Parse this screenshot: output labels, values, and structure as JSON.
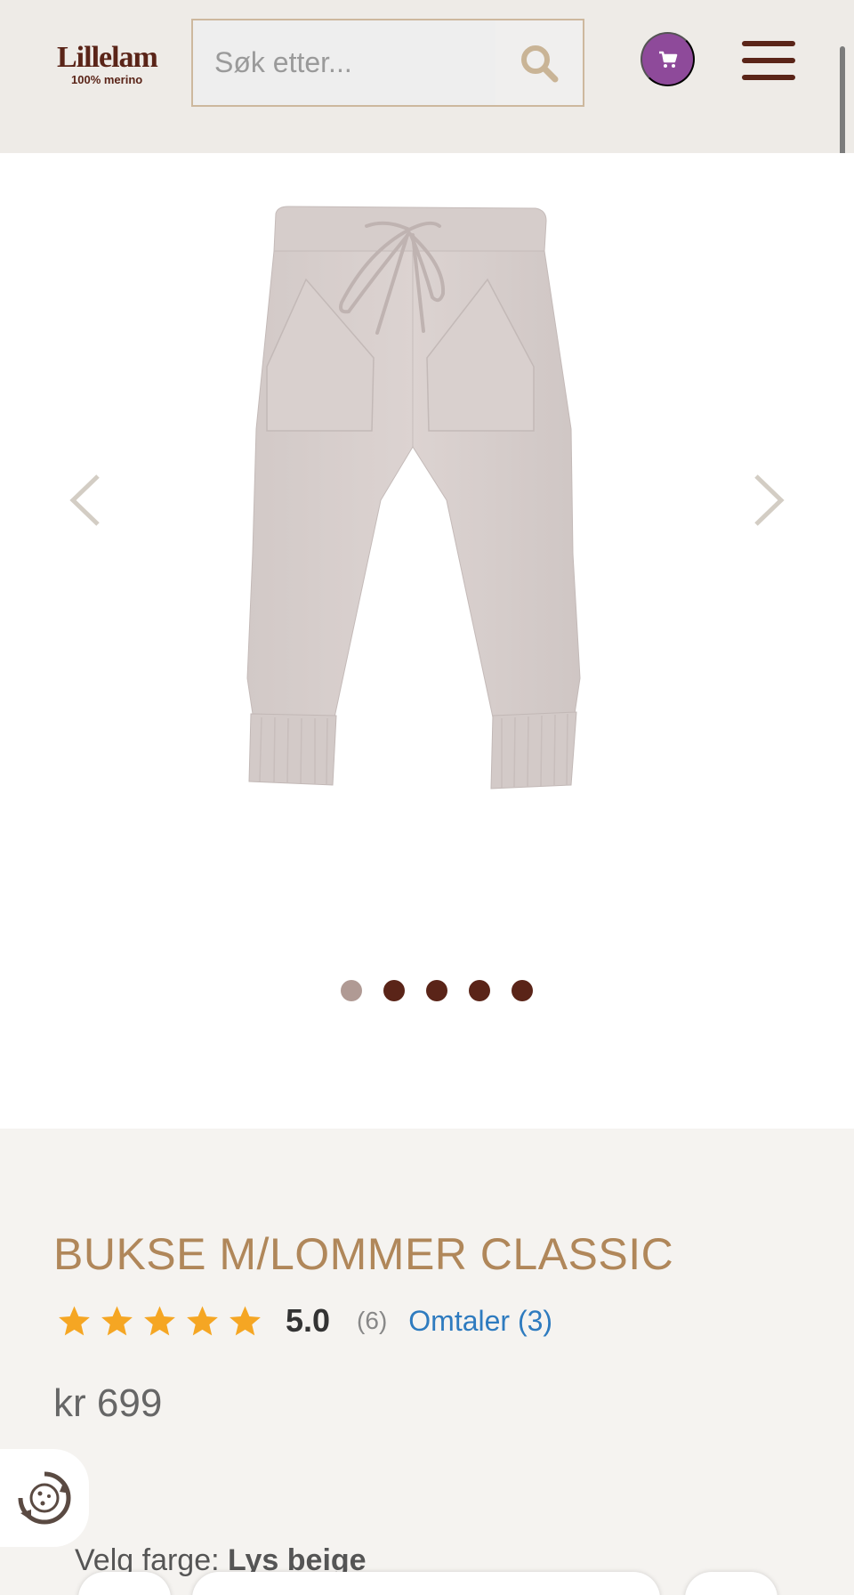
{
  "header": {
    "logo_name": "Lillelam",
    "logo_sub": "100% merino",
    "search_placeholder": "Søk etter...",
    "icons": {
      "search": "search-icon",
      "cart": "cart-icon",
      "menu": "hamburger-menu-icon"
    }
  },
  "gallery": {
    "slide_count": 5,
    "active_slide": 1,
    "image_alt": "Bukse m/lommer classic, lys beige"
  },
  "product": {
    "title": "BUKSE M/LOMMER CLASSIC",
    "rating": "5.0",
    "stars": 5,
    "rating_count": "(6)",
    "reviews_link": "Omtaler (3)",
    "price": "kr 699",
    "color_label": "Velg farge:",
    "color_value": "Lys beige"
  },
  "colors": {
    "header_bg": "#eeebe7",
    "brand_brown": "#5a2418",
    "title_gold": "#b0875a",
    "cart_purple": "#8e4a9a",
    "link_blue": "#2e7bbf",
    "star_orange": "#f5a623"
  }
}
